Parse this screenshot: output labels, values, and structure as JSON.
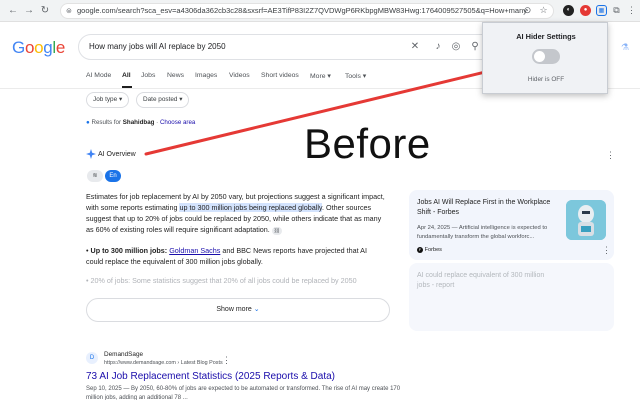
{
  "browser": {
    "url": "google.com/search?sca_esv=a4306da362cb3c28&sxsrf=AE3TifP83I2Z7QVDWgP6RKbpgMBW83Hwg:1764009527505&q=How+many+j..."
  },
  "google": {
    "logo": "Google",
    "query": "How many jobs will AI replace by 2050",
    "tabs": [
      "AI Mode",
      "All",
      "Jobs",
      "News",
      "Images",
      "Videos",
      "Short videos",
      "More",
      "Tools"
    ],
    "filters": [
      "Job type",
      "Date posted"
    ],
    "results_for_prefix": "Results for",
    "results_for_location": "Shahidbag",
    "choose_area": "Choose area",
    "ai_overview": {
      "title": "AI Overview",
      "lang_badge": "En",
      "para_part1": "Estimates for job replacement by AI by 2050 vary, but projections suggest a significant impact, with some reports estimating ",
      "para_highlight": "up to 300 million jobs being replaced globally",
      "para_part2": ". Other sources suggest that up to 20% of jobs could be replaced by 2050, while others indicate that as many as 60% of existing roles will require significant adaptation.",
      "bullet1_bold": "Up to 300 million jobs:",
      "bullet1_link": "Goldman Sachs",
      "bullet1_rest": " and BBC News reports have projected that AI could replace the equivalent of 300 million jobs globally.",
      "bullet2": "20% of jobs: Some statistics suggest that 20% of all jobs could be replaced by 2050",
      "show_more": "Show more"
    },
    "cards": [
      {
        "title": "Jobs AI Will Replace First in the Workplace Shift - Forbes",
        "date_snippet": "Apr 24, 2025 — Artificial intelligence is expected to fundamentally transform the global workforc...",
        "source": "Forbes"
      },
      {
        "title": "AI could replace equivalent of 300 million jobs - report"
      }
    ],
    "result": {
      "site": "DemandSage",
      "url": "https://www.demandsage.com › Latest Blog Posts",
      "title": "73 AI Job Replacement Statistics (2025 Reports & Data)",
      "snippet": "Sep 10, 2025 — By 2050, 60-80% of jobs are expected to be automated or transformed. The rise of AI may create 170 million jobs, adding an additional 78 ..."
    }
  },
  "extension_popup": {
    "title": "AI Hider Settings",
    "status": "Hider is OFF",
    "toggle_on": false
  },
  "annotation": {
    "label": "Before",
    "arrow_color": "#e53935"
  }
}
